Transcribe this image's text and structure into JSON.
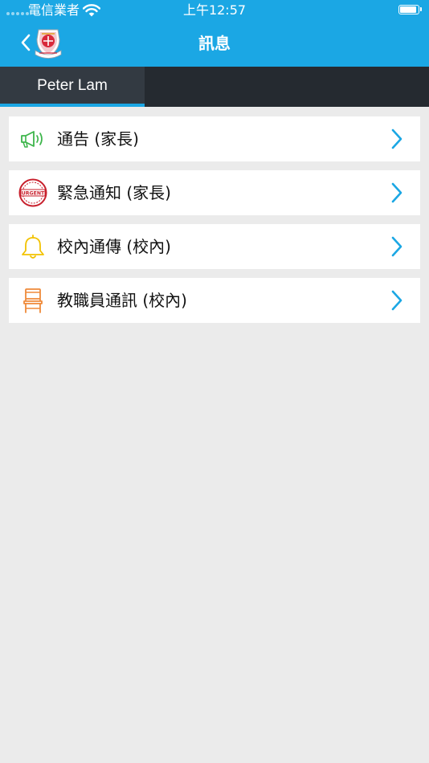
{
  "status_bar": {
    "carrier": "電信業者",
    "time": "上午12:57",
    "battery_level": 0.92
  },
  "nav": {
    "title": "訊息",
    "back_icon": "back-chevron-icon",
    "logo_icon": "school-crest-icon"
  },
  "tabs": [
    {
      "label": "Peter Lam",
      "selected": true
    }
  ],
  "menu": [
    {
      "label": "通告 (家長)",
      "icon": "megaphone-icon",
      "icon_color": "#3cb54a"
    },
    {
      "label": "緊急通知 (家長)",
      "icon": "urgent-stamp-icon",
      "icon_color": "#c8202d",
      "icon_text": "URGENT"
    },
    {
      "label": "校內通傳 (校內)",
      "icon": "bell-icon",
      "icon_color": "#f2c200"
    },
    {
      "label": "教職員通訊 (校內)",
      "icon": "chair-icon",
      "icon_color": "#ef8a3a"
    }
  ],
  "colors": {
    "accent": "#1ba7e4",
    "tabbar": "#252a30",
    "background": "#ebebeb"
  }
}
